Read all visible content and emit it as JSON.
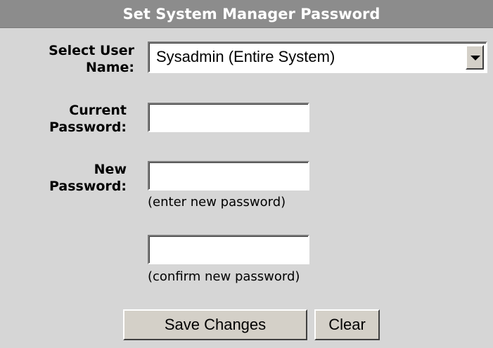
{
  "title": "Set System Manager Password",
  "user_name": {
    "label_line1": "Select User",
    "label_line2": "Name:",
    "selected": "Sysadmin (Entire System)"
  },
  "current_password": {
    "label_line1": "Current",
    "label_line2": "Password:",
    "value": ""
  },
  "new_password": {
    "label_line1": "New",
    "label_line2": "Password:",
    "value": "",
    "hint": "(enter new password)"
  },
  "confirm_password": {
    "value": "",
    "hint": "(confirm new password)"
  },
  "buttons": {
    "save": "Save Changes",
    "clear": "Clear"
  },
  "colors": {
    "title_bar_bg": "#8c8c8c",
    "panel_bg": "#d6d6d6",
    "button_face": "#d4d0c8"
  }
}
